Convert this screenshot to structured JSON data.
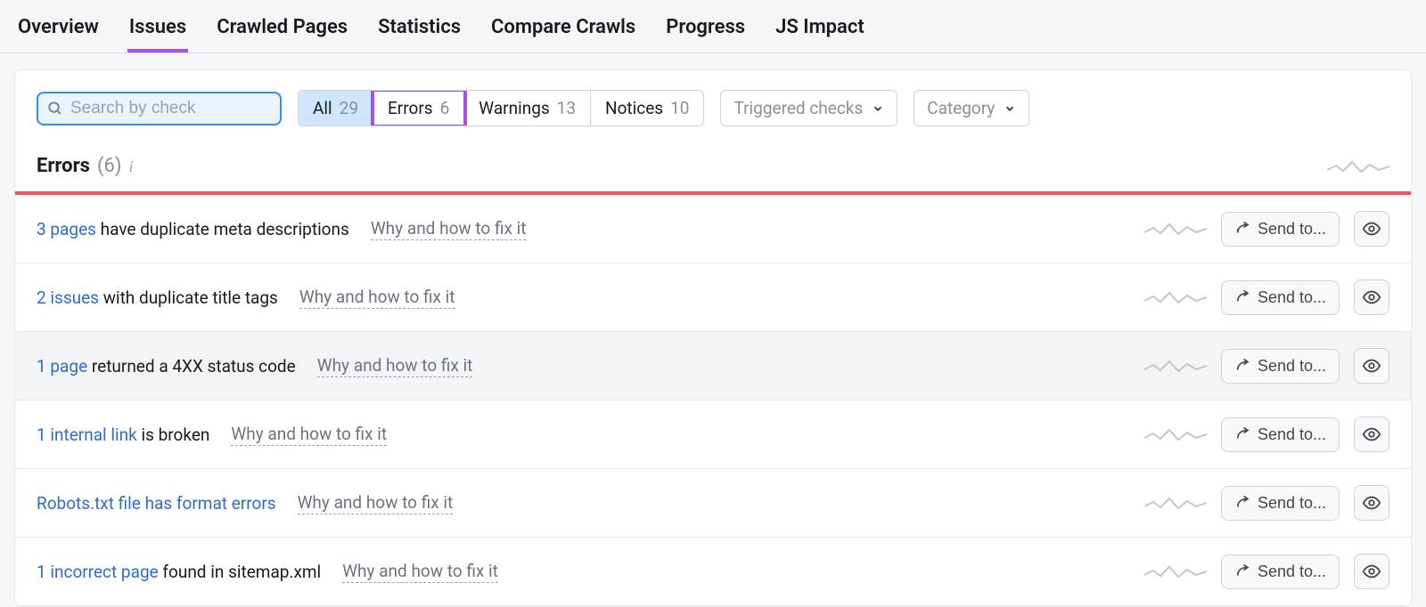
{
  "nav": {
    "tabs": [
      {
        "label": "Overview"
      },
      {
        "label": "Issues"
      },
      {
        "label": "Crawled Pages"
      },
      {
        "label": "Statistics"
      },
      {
        "label": "Compare Crawls"
      },
      {
        "label": "Progress"
      },
      {
        "label": "JS Impact"
      }
    ],
    "active_index": 1
  },
  "search": {
    "placeholder": "Search by check",
    "value": ""
  },
  "filter_segments": [
    {
      "label": "All",
      "count": "29",
      "active": true,
      "highlight": false
    },
    {
      "label": "Errors",
      "count": "6",
      "active": false,
      "highlight": true
    },
    {
      "label": "Warnings",
      "count": "13",
      "active": false,
      "highlight": false
    },
    {
      "label": "Notices",
      "count": "10",
      "active": false,
      "highlight": false
    }
  ],
  "dropdowns": {
    "triggered_label": "Triggered checks",
    "category_label": "Category"
  },
  "section": {
    "title": "Errors",
    "count_display": "(6)"
  },
  "row_actions": {
    "send_label": "Send to...",
    "fix_label": "Why and how to fix it"
  },
  "rows": [
    {
      "link_text": "3 pages",
      "rest": " have duplicate meta descriptions",
      "hover": false
    },
    {
      "link_text": "2 issues",
      "rest": " with duplicate title tags",
      "hover": false
    },
    {
      "link_text": "1 page",
      "rest": " returned a 4XX status code",
      "hover": true
    },
    {
      "link_text": "1 internal link",
      "rest": " is broken",
      "hover": false
    },
    {
      "link_text": "Robots.txt file has format errors",
      "rest": "",
      "hover": false
    },
    {
      "link_text": "1 incorrect page",
      "rest": " found in sitemap.xml",
      "hover": false
    }
  ]
}
